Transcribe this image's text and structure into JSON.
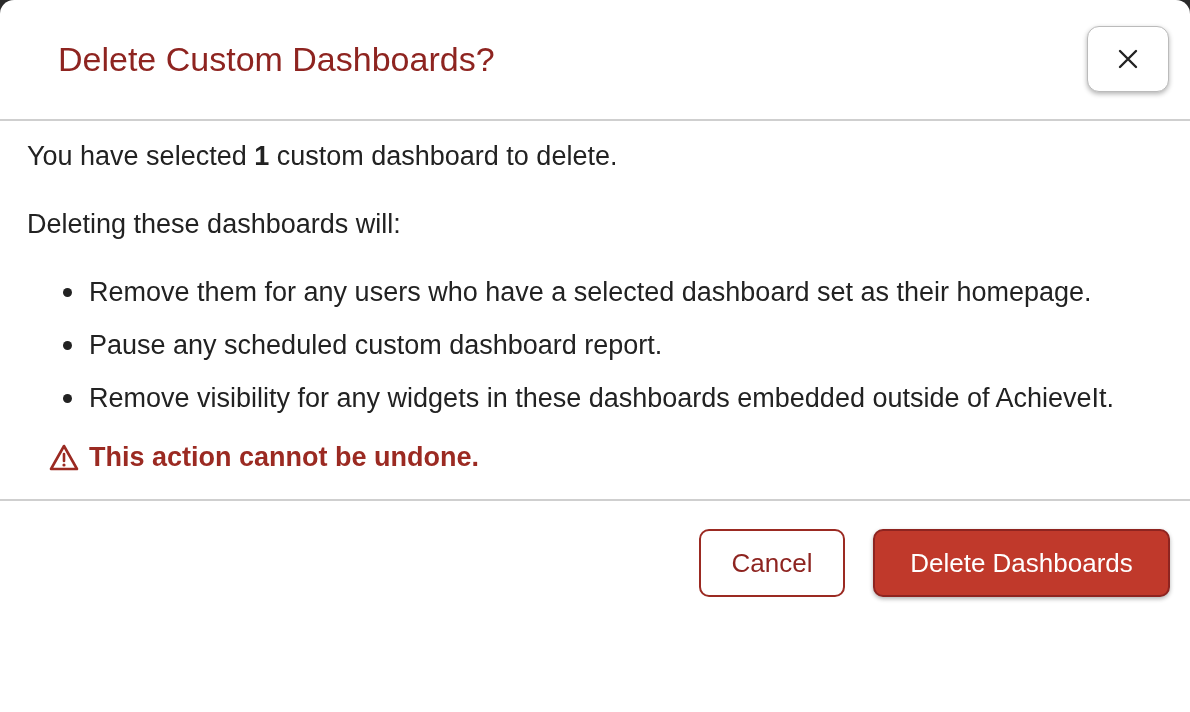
{
  "dialog": {
    "title": "Delete Custom Dashboards?",
    "intro": "You have selected **1** custom dashboard to delete.",
    "lead": "Deleting these dashboards will:",
    "consequences": [
      "Remove them for any users who have a selected dashboard set as their homepage.",
      "Pause any scheduled custom dashboard report.",
      "Remove visibility for any widgets in these dashboards embedded outside of AchieveIt."
    ],
    "warning": "This action cannot be undone.",
    "buttons": [
      {
        "label": "Cancel",
        "kind": "secondary"
      },
      {
        "label": "Delete Dashboards",
        "kind": "primary"
      }
    ]
  }
}
